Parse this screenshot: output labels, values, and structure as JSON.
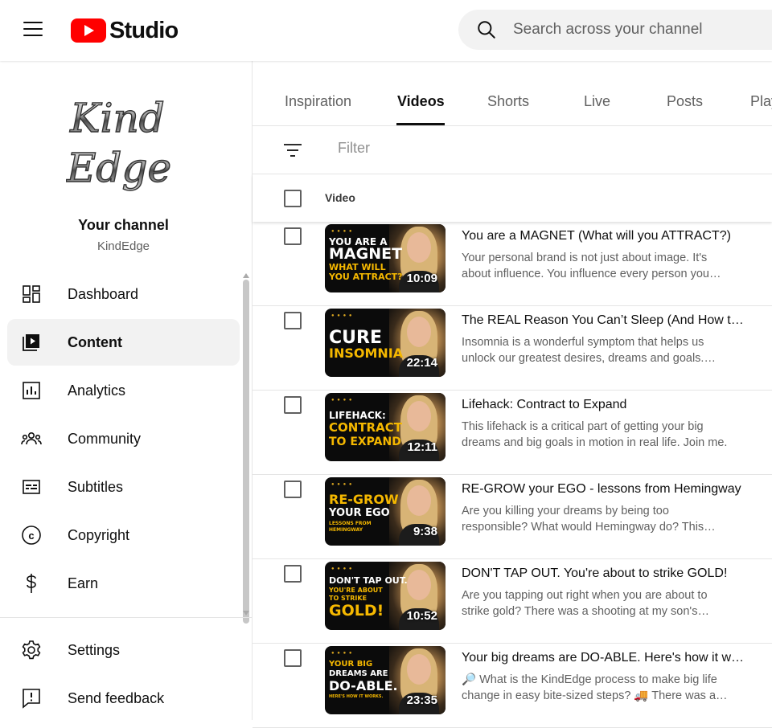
{
  "header": {
    "app_name": "Studio",
    "search_placeholder": "Search across your channel"
  },
  "sidebar": {
    "channel_logo_text": "Kind Edge",
    "channel_title": "Your channel",
    "channel_handle": "KindEdge",
    "items": [
      {
        "label": "Dashboard",
        "icon": "dashboard-icon"
      },
      {
        "label": "Content",
        "icon": "content-icon",
        "active": true
      },
      {
        "label": "Analytics",
        "icon": "analytics-icon"
      },
      {
        "label": "Community",
        "icon": "community-icon"
      },
      {
        "label": "Subtitles",
        "icon": "subtitles-icon"
      },
      {
        "label": "Copyright",
        "icon": "copyright-icon"
      },
      {
        "label": "Earn",
        "icon": "earn-icon"
      }
    ],
    "bottom_items": [
      {
        "label": "Settings",
        "icon": "gear-icon"
      },
      {
        "label": "Send feedback",
        "icon": "feedback-icon"
      }
    ]
  },
  "main": {
    "tabs": [
      {
        "label": "Inspiration"
      },
      {
        "label": "Videos",
        "active": true
      },
      {
        "label": "Shorts"
      },
      {
        "label": "Live"
      },
      {
        "label": "Posts"
      },
      {
        "label": "Playlists"
      }
    ],
    "filter_placeholder": "Filter",
    "column_video": "Video",
    "videos": [
      {
        "title": "You are a MAGNET (What will you ATTRACT?)",
        "description": "Your personal brand is not just about image. It's about influence. You influence every person you meet.",
        "duration": "10:09",
        "thumb_line1": "YOU ARE A",
        "thumb_line2": "MAGNET",
        "thumb_line3": "WHAT WILL",
        "thumb_line4": "YOU ATTRACT?"
      },
      {
        "title": "The REAL Reason You Can’t Sleep (And How to Fix It)",
        "description": "Insomnia is a wonderful symptom that helps us unlock our greatest desires, dreams and goals. Here's how.",
        "duration": "22:14",
        "thumb_line1": "CURE",
        "thumb_line2": "INSOMNIA"
      },
      {
        "title": "Lifehack: Contract to Expand",
        "description": "This lifehack is a critical part of getting your big dreams and big goals in motion in real life. Join me.",
        "duration": "12:11",
        "thumb_line1": "LIFEHACK:",
        "thumb_line2": "CONTRACT",
        "thumb_line3": "TO EXPAND"
      },
      {
        "title": "RE-GROW your EGO - lessons from Hemingway",
        "description": "Are you killing your dreams by being too responsible? What would Hemingway do? This lesson explains.",
        "duration": "9:38",
        "thumb_line1": "RE-GROW",
        "thumb_line2": "YOUR EGO",
        "thumb_line3": "LESSONS FROM",
        "thumb_line4": "HEMINGWAY"
      },
      {
        "title": "DON'T TAP OUT. You're about to strike GOLD!",
        "description": "Are you tapping out right when you are about to strike gold? There was a shooting at my son's school.",
        "duration": "10:52",
        "thumb_line1": "DON'T TAP OUT.",
        "thumb_line2": "YOU'RE ABOUT",
        "thumb_line3": "TO STRIKE",
        "thumb_line4": "GOLD!"
      },
      {
        "title": "Your big dreams are DO-ABLE. Here's how it works.",
        "description": "🔎 What is the KindEdge process to make big life change in easy bite-sized steps? 🚚 There was a time.",
        "duration": "23:35",
        "thumb_line1": "YOUR BIG",
        "thumb_line2": "DREAMS ARE",
        "thumb_line3": "DO-ABLE.",
        "thumb_line4": "HERE'S HOW IT WORKS."
      }
    ]
  },
  "colors": {
    "youtube_red": "#ff0000",
    "thumb_gold": "#f5b800",
    "active_bg": "#f2f2f2"
  }
}
